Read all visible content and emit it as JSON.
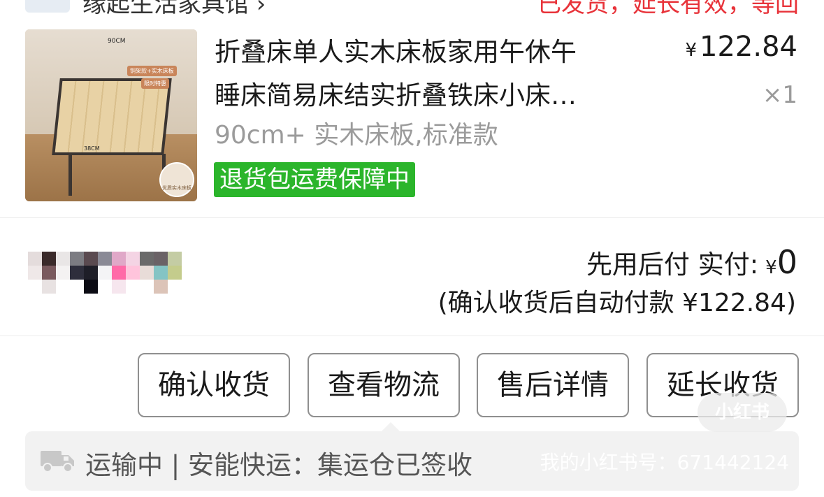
{
  "shop": {
    "name": "缘起生活家具馆 ›",
    "status": "已发货，延长有效，等回"
  },
  "product": {
    "title_line1": "折叠床单人实木床板家用午休午",
    "title_line2": "睡床简易床结实折叠铁床小床…",
    "currency": "¥",
    "price": "122.84",
    "quantity": "×1",
    "variant": "90cm+ 实木床板,标准款",
    "return_badge": "退货包运费保障中",
    "image_text": {
      "width_label": "90CM",
      "tag1": "铜架款+实木床板",
      "tag2": "限时特惠",
      "height_label": "38CM",
      "circle_label": "优质实木床板"
    }
  },
  "payment": {
    "label": "先用后付 实付:",
    "currency": "¥",
    "amount": "0",
    "note": "(确认收货后自动付款 ¥122.84)"
  },
  "actions": {
    "confirm": "确认收货",
    "logistics": "查看物流",
    "after_sale": "售后详情",
    "extend": "延长收货"
  },
  "logistics": {
    "icon": "truck-icon",
    "text": "运输中 | 安能快运：集运仓已签收"
  },
  "watermark": {
    "logo": "小红书",
    "text": "我的小红书号：671442124"
  },
  "colors": {
    "status_red": "#e8333a",
    "return_green": "#2bb52b",
    "logistics_bg": "#f2f2f2"
  }
}
